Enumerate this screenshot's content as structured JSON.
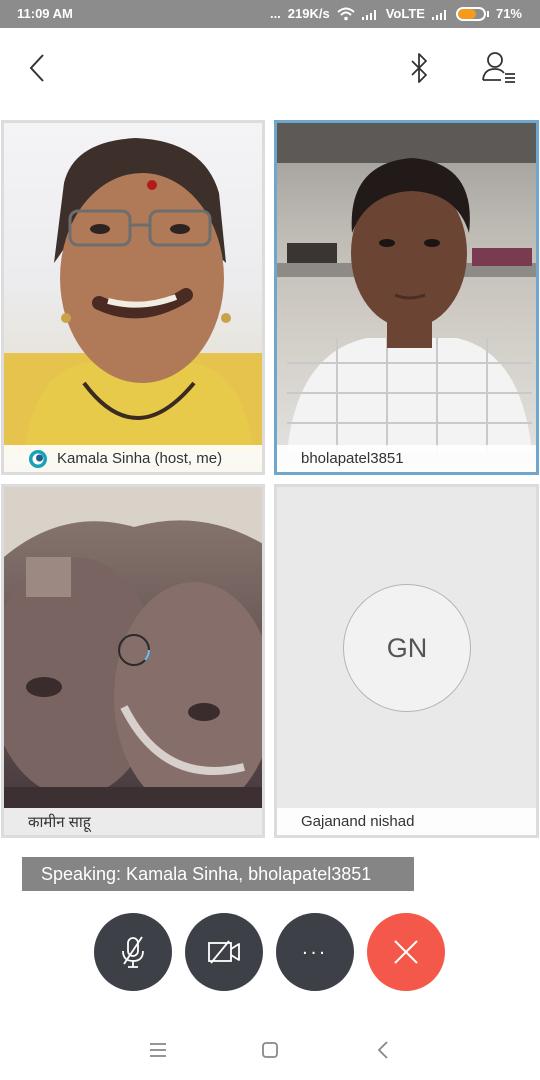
{
  "status_bar": {
    "time": "11:09 AM",
    "dots": "...",
    "net_speed": "219K/s",
    "network_label": "VoLTE",
    "battery": "71%",
    "battery_level": 0.71,
    "battery_color": "#f39b1a"
  },
  "app_bar": {
    "back_icon": "back-chevron-icon",
    "bluetooth_icon": "bluetooth-icon",
    "participants_icon": "participants-list-icon"
  },
  "participants": [
    {
      "name": "Kamala Sinha (host, me)",
      "video": true,
      "host_icon": "host-badge-icon"
    },
    {
      "name": "bholapatel3851",
      "video": true,
      "active_speaker": true
    },
    {
      "name": "कामीन साहू",
      "video": true
    },
    {
      "name": "Gajanand nishad",
      "video": false,
      "initials": "GN"
    }
  ],
  "speaking": {
    "text": "Speaking: Kamala Sinha, bholapatel3851"
  },
  "controls": {
    "mute_icon": "microphone-off-icon",
    "video_icon": "camera-off-icon",
    "more_label": "...",
    "end_icon": "close-x-icon",
    "end_color": "#f4584a"
  },
  "nav_bar": {
    "menu_icon": "menu-icon",
    "home_icon": "home-square-icon",
    "back_icon": "nav-back-icon"
  }
}
